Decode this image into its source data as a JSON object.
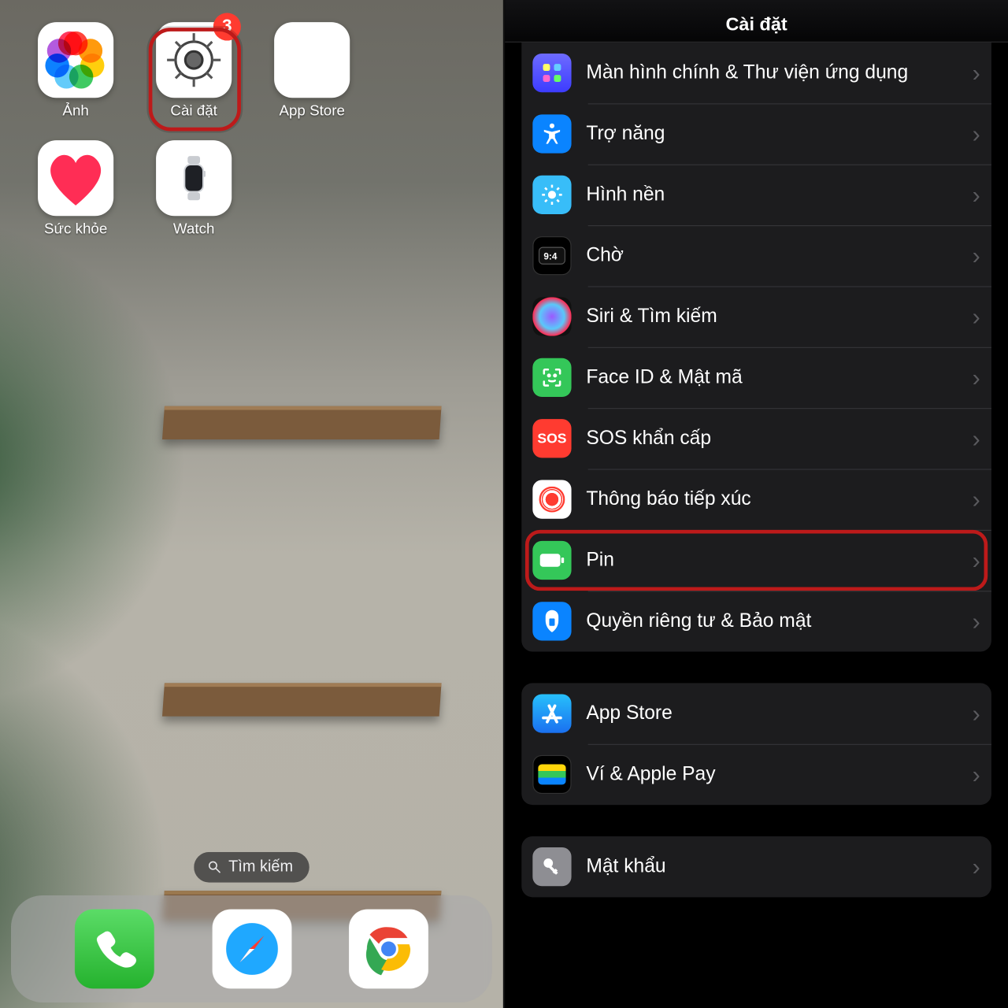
{
  "homescreen": {
    "apps": [
      {
        "id": "photos",
        "label": "Ảnh"
      },
      {
        "id": "settings",
        "label": "Cài đặt",
        "badge": "3",
        "highlighted": true
      },
      {
        "id": "appstore",
        "label": "App Store"
      },
      {
        "id": "health",
        "label": "Sức khỏe"
      },
      {
        "id": "watch",
        "label": "Watch"
      }
    ],
    "search_label": "Tìm kiếm",
    "dock": [
      "phone",
      "safari",
      "chrome"
    ]
  },
  "settings": {
    "title": "Cài đặt",
    "groups": [
      {
        "rows": [
          {
            "id": "home",
            "label": "Màn hình chính & Thư viện ứng dụng",
            "truncated_first_line": true
          },
          {
            "id": "access",
            "label": "Trợ năng"
          },
          {
            "id": "wall",
            "label": "Hình nền"
          },
          {
            "id": "standby",
            "label": "Chờ"
          },
          {
            "id": "siri",
            "label": "Siri & Tìm kiếm"
          },
          {
            "id": "face",
            "label": "Face ID & Mật mã"
          },
          {
            "id": "sos",
            "label": "SOS khẩn cấp",
            "icon_text": "SOS"
          },
          {
            "id": "exposure",
            "label": "Thông báo tiếp xúc"
          },
          {
            "id": "battery",
            "label": "Pin",
            "highlighted": true
          },
          {
            "id": "privacy",
            "label": "Quyền riêng tư & Bảo mật"
          }
        ]
      },
      {
        "rows": [
          {
            "id": "appstore2",
            "label": "App Store"
          },
          {
            "id": "wallet",
            "label": "Ví & Apple Pay"
          }
        ]
      },
      {
        "rows": [
          {
            "id": "password",
            "label": "Mật khẩu"
          }
        ]
      }
    ]
  }
}
